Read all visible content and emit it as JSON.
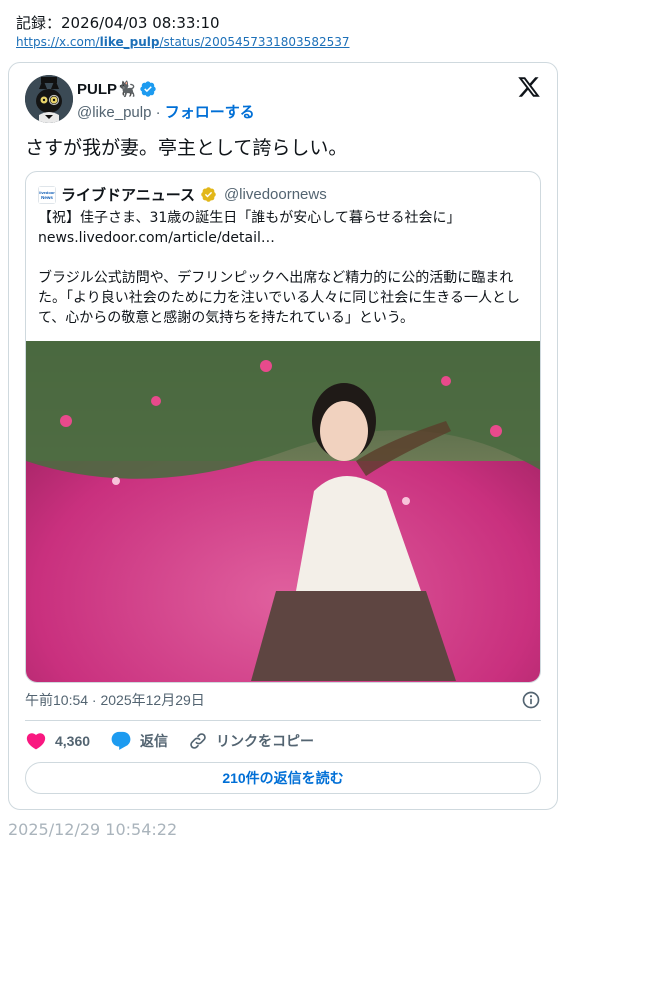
{
  "record": "記録：2026/04/03 08:33:10",
  "source_url": {
    "prefix": "https://x.com/",
    "bold": "like_pulp",
    "suffix": "/status/2005457331803582537"
  },
  "tweet": {
    "author_name": "PULP🐈‍⬛",
    "handle": "@like_pulp",
    "separator": " · ",
    "follow_label": "フォローする",
    "text": "さすが我が妻。亭主として誇らしい。",
    "timestamp": "午前10:54 · 2025年12月29日",
    "likes": "4,360",
    "reply_label": "返信",
    "copy_link_label": "リンクをコピー",
    "read_replies_label": "210件の返信を読む"
  },
  "quote": {
    "logo_text": "livedoor News",
    "author_name": "ライブドアニュース",
    "handle": "@livedoornews",
    "line1": "【祝】佳子さま、31歳の誕生日「誰もが安心して暮らせる社会に」",
    "line2": "news.livedoor.com/article/detail…",
    "paragraph": "ブラジル公式訪問や、デフリンピックへ出席など精力的に公的活動に臨まれた。「より良い社会のために力を注いでいる人々に同じ社会に生きる一人として、心からの敬意と感謝の気持ちを持たれている」という。"
  },
  "footer_date": "2025/12/29 10:54:22",
  "colors": {
    "accent": "#1d9bf0",
    "follow": "#006fd6",
    "like": "#f91880",
    "gold_badge": "#e2b719",
    "border": "#cfd9de",
    "muted": "#536471"
  },
  "icons": {
    "verified": "verified-badge-icon",
    "gold_verified": "gold-verified-badge-icon",
    "x_logo": "x-logo-icon",
    "info": "info-icon",
    "heart": "heart-icon",
    "reply": "reply-bubble-icon",
    "link": "link-icon"
  }
}
